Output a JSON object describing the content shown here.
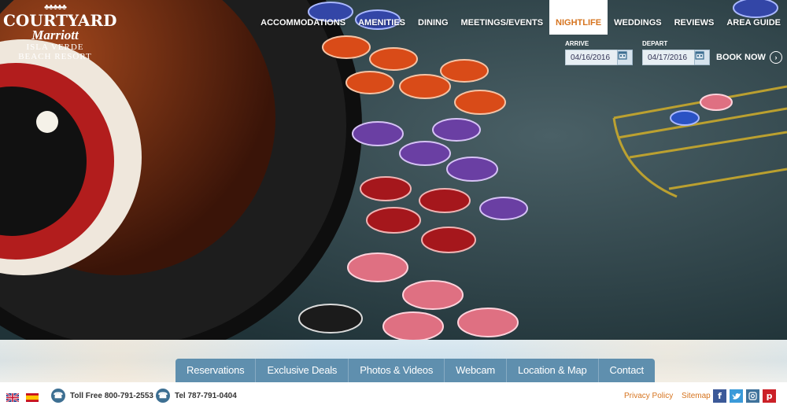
{
  "logo": {
    "brand": "COURTYARD",
    "sub": "Marriott",
    "location_line1": "ISLA VERDE",
    "location_line2": "BEACH RESORT"
  },
  "nav": {
    "items": [
      {
        "label": "ACCOMMODATIONS"
      },
      {
        "label": "AMENITIES"
      },
      {
        "label": "DINING"
      },
      {
        "label": "MEETINGS/EVENTS"
      },
      {
        "label": "NIGHTLIFE",
        "active": true
      },
      {
        "label": "WEDDINGS"
      },
      {
        "label": "REVIEWS"
      },
      {
        "label": "AREA GUIDE"
      }
    ]
  },
  "booking": {
    "arrive_label": "ARRIVE",
    "arrive_value": "04/16/2016",
    "depart_label": "DEPART",
    "depart_value": "04/17/2016",
    "book_label": "BOOK NOW"
  },
  "tabs": {
    "items": [
      {
        "label": "Reservations"
      },
      {
        "label": "Exclusive Deals"
      },
      {
        "label": "Photos & Videos"
      },
      {
        "label": "Webcam"
      },
      {
        "label": "Location & Map"
      },
      {
        "label": "Contact"
      }
    ]
  },
  "footer": {
    "toll_free": "Toll Free 800-791-2553",
    "tel": "Tel 787-791-0404",
    "privacy": "Privacy Policy",
    "sitemap": "Sitemap"
  },
  "colors": {
    "accent": "#d6741f",
    "tab_bg": "#5f8fae",
    "phone_icon": "#3d6f92"
  },
  "icons": {
    "flags": [
      "uk-flag-icon",
      "spain-flag-icon"
    ],
    "social": [
      "facebook-icon",
      "twitter-icon",
      "instagram-icon",
      "pinterest-icon"
    ]
  }
}
